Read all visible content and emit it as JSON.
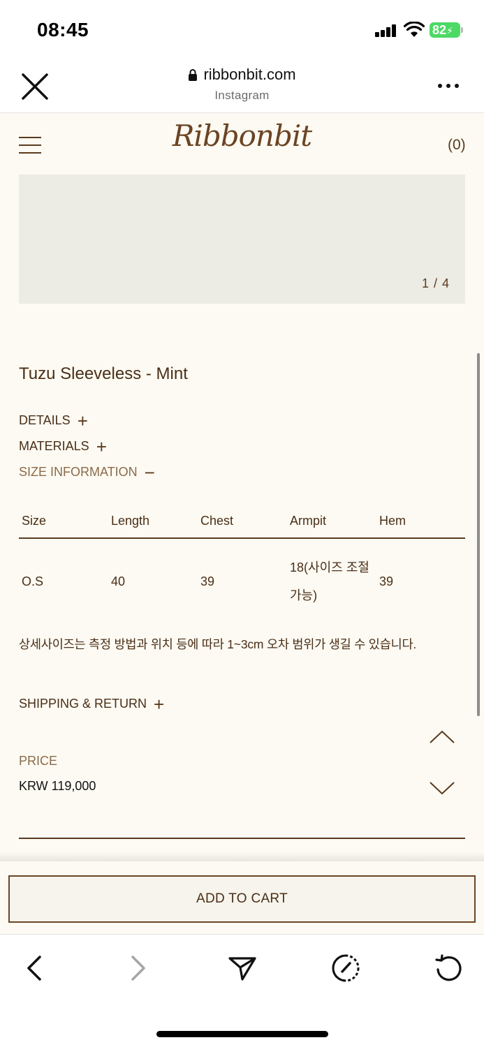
{
  "status_bar": {
    "time": "08:45",
    "battery": "82"
  },
  "browser": {
    "url": "ribbonbit.com",
    "subtitle": "Instagram"
  },
  "site": {
    "logo": "Ribbonbit",
    "cart_count": "(0)"
  },
  "gallery": {
    "counter": "1 / 4"
  },
  "product": {
    "title": "Tuzu Sleeveless - Mint",
    "sections": {
      "details": "DETAILS",
      "materials": "MATERIALS",
      "size_information": "SIZE INFORMATION",
      "shipping_return": "SHIPPING & RETURN"
    },
    "size_table": {
      "headers": [
        "Size",
        "Length",
        "Chest",
        "Armpit",
        "Hem"
      ],
      "rows": [
        [
          "O.S",
          "40",
          "39",
          "18(사이즈 조절 가능)",
          "39"
        ]
      ]
    },
    "size_note": "상세사이즈는 측정 방법과 위치 등에 따라 1~3cm 오차 범위가 생길 수 있습니다.",
    "price_label": "PRICE",
    "price_value": "KRW 119,000",
    "add_to_cart": "ADD TO CART"
  },
  "colors": {
    "page_bg": "#fcfaf2",
    "brand_brown": "#5a3a1e",
    "accent_text": "#8b6a4a",
    "battery_green": "#4cd964"
  },
  "icons": {
    "toolbar": [
      "back-icon",
      "forward-icon",
      "share-icon",
      "compass-icon",
      "reload-icon"
    ]
  }
}
